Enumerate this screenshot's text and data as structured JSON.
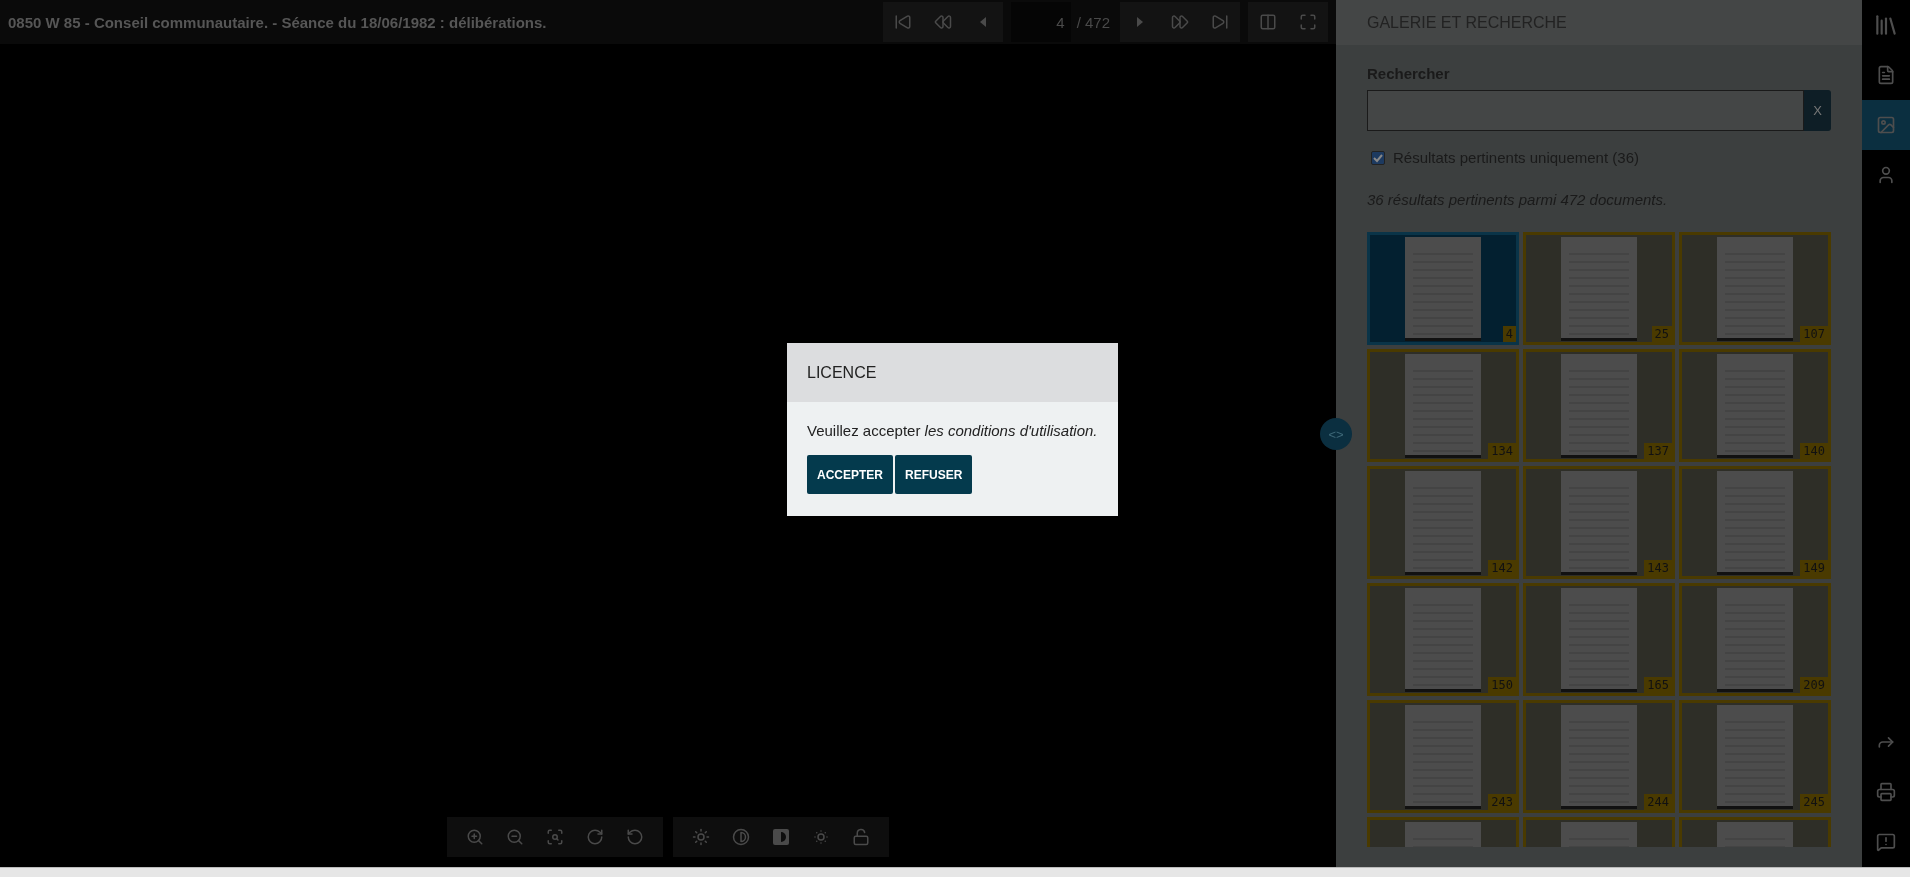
{
  "document_title": "0850 W 85 - Conseil communautaire. - Séance du 18/06/1982 : délibérations.",
  "pager": {
    "page": "4",
    "total": "/ 472"
  },
  "panel_toggle": "<>",
  "dialog": {
    "title": "LICENCE",
    "message": "Veuillez accepter *les conditions d'utilisation.*",
    "buttons": [
      "ACCEPTER",
      "REFUSER"
    ]
  },
  "panel": {
    "title": "GALERIE ET RECHERCHE",
    "search_label": "Rechercher",
    "clear_button": "X",
    "filter": {
      "label": "Résultats pertinents uniquement (36)",
      "checked": true
    },
    "summary": "36 résultats pertinents parmi 472 documents.",
    "thumbnails": [
      {
        "page": "4",
        "selected": true
      },
      {
        "page": "25",
        "selected": false
      },
      {
        "page": "107",
        "selected": false
      },
      {
        "page": "134",
        "selected": false
      },
      {
        "page": "137",
        "selected": false
      },
      {
        "page": "140",
        "selected": false
      },
      {
        "page": "142",
        "selected": false
      },
      {
        "page": "143",
        "selected": false
      },
      {
        "page": "149",
        "selected": false
      },
      {
        "page": "150",
        "selected": false
      },
      {
        "page": "165",
        "selected": false
      },
      {
        "page": "209",
        "selected": false
      },
      {
        "page": "243",
        "selected": false
      },
      {
        "page": "244",
        "selected": false
      },
      {
        "page": "245",
        "selected": false
      }
    ],
    "cut_thumbnails": [
      {
        "selected": false
      },
      {
        "selected": false
      },
      {
        "selected": false
      }
    ]
  },
  "rail": {
    "items": [
      {
        "kind": "info",
        "selected": false
      },
      {
        "kind": "gallery",
        "selected": true
      },
      {
        "kind": "user",
        "selected": false
      }
    ]
  }
}
